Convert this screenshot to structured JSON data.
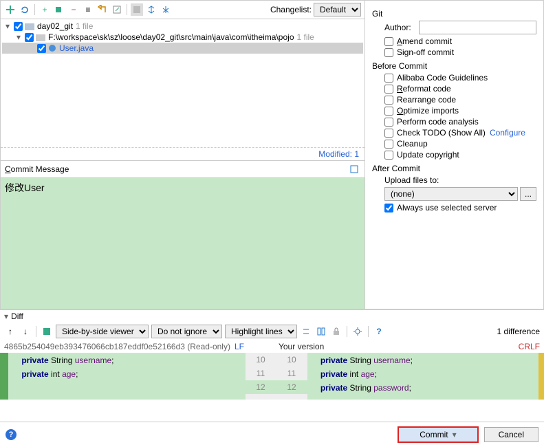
{
  "toolbar": {
    "changelist_label": "Changelist:",
    "changelist_value": "Default"
  },
  "tree": {
    "root": {
      "name": "day02_git",
      "count": "1 file"
    },
    "path": {
      "name": "F:\\workspace\\sk\\sz\\loose\\day02_git\\src\\main\\java\\com\\itheima\\pojo",
      "count": "1 file"
    },
    "file": {
      "name": "User.java"
    },
    "modified": "Modified: 1"
  },
  "commit_message": {
    "header": "Commit Message",
    "value": "修改User"
  },
  "git": {
    "title": "Git",
    "author_label": "Author:",
    "amend": "Amend commit",
    "signoff": "Sign-off commit"
  },
  "before": {
    "title": "Before Commit",
    "items": [
      "Alibaba Code Guidelines",
      "Reformat code",
      "Rearrange code",
      "Optimize imports",
      "Perform code analysis",
      "Check TODO (Show All)",
      "Cleanup",
      "Update copyright"
    ],
    "configure": "Configure"
  },
  "after": {
    "title": "After Commit",
    "upload_label": "Upload files to:",
    "upload_value": "(none)",
    "always_selected": "Always use selected server"
  },
  "diff": {
    "header": "Diff",
    "viewer": "Side-by-side viewer",
    "ignore": "Do not ignore",
    "highlight": "Highlight lines",
    "count": "1 difference",
    "hash": "4865b254049eb393476066cb187eddf0e52166d3 (Read-only)",
    "lf": "LF",
    "your_version": "Your version",
    "crlf": "CRLF",
    "left": {
      "l1": {
        "kw": "private",
        "type": "String",
        "id": "username"
      },
      "l2": {
        "kw": "private",
        "type": "int",
        "id": "age"
      }
    },
    "right": {
      "l1": {
        "kw": "private",
        "type": "String",
        "id": "username"
      },
      "l2": {
        "kw": "private",
        "type": "int",
        "id": "age"
      },
      "l3": {
        "kw": "private",
        "type": "String",
        "id": "password"
      }
    },
    "gutters": {
      "g10": "10",
      "g11": "11",
      "g12": "12"
    }
  },
  "buttons": {
    "commit": "Commit",
    "cancel": "Cancel"
  }
}
